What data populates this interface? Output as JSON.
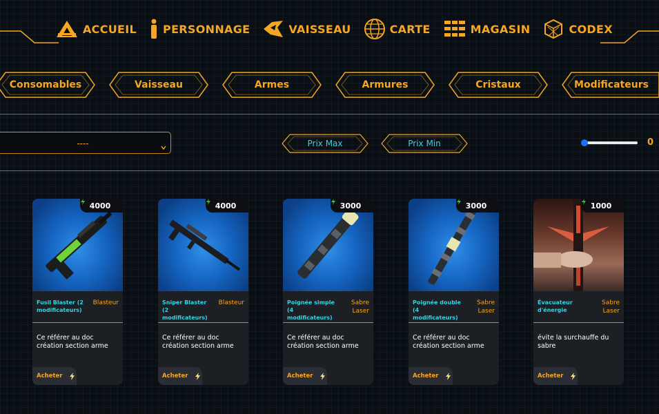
{
  "nav": {
    "items": [
      {
        "label": "ACCUEIL",
        "icon": "home-icon"
      },
      {
        "label": "PERSONNAGE",
        "icon": "person-icon"
      },
      {
        "label": "VAISSEAU",
        "icon": "ship-icon"
      },
      {
        "label": "CARTE",
        "icon": "globe-icon"
      },
      {
        "label": "MAGASIN",
        "icon": "shop-icon"
      },
      {
        "label": "CODEX",
        "icon": "codex-icon"
      }
    ]
  },
  "categories": [
    "Consomables",
    "Vaisseau",
    "Armes",
    "Armures",
    "Cristaux",
    "Modificateurs"
  ],
  "filters": {
    "select_value": "----",
    "price_max": "Prix Max",
    "price_min": "Prix Min",
    "slider_value": "0"
  },
  "colors": {
    "accent": "#f5a623",
    "cyan": "#2fd6e6",
    "card_bg": "#1c1f24",
    "background": "#0b0f14"
  },
  "cards": [
    {
      "price": "4000",
      "name": "Fusil Blaster (2 modificateurs)",
      "type": "Blasteur",
      "description": "Ce référer au doc création section arme",
      "buy": "Acheter"
    },
    {
      "price": "4000",
      "name": "Sniper Blaster (2 modificateurs)",
      "type": "Blasteur",
      "description": "Ce référer au doc création section arme",
      "buy": "Acheter"
    },
    {
      "price": "3000",
      "name": "Poignée simple (4 modificateurs)",
      "type": "Sabre Laser",
      "description": "Ce référer au doc création section arme",
      "buy": "Acheter"
    },
    {
      "price": "3000",
      "name": "Poignée double (4 modificateurs)",
      "type": "Sabre Laser",
      "description": "Ce référer au doc création section arme",
      "buy": "Acheter"
    },
    {
      "price": "1000",
      "name": "Évacuateur d'énergie",
      "type": "Sabre Laser",
      "description": "évite la surchauffe du sabre",
      "buy": "Acheter"
    }
  ]
}
